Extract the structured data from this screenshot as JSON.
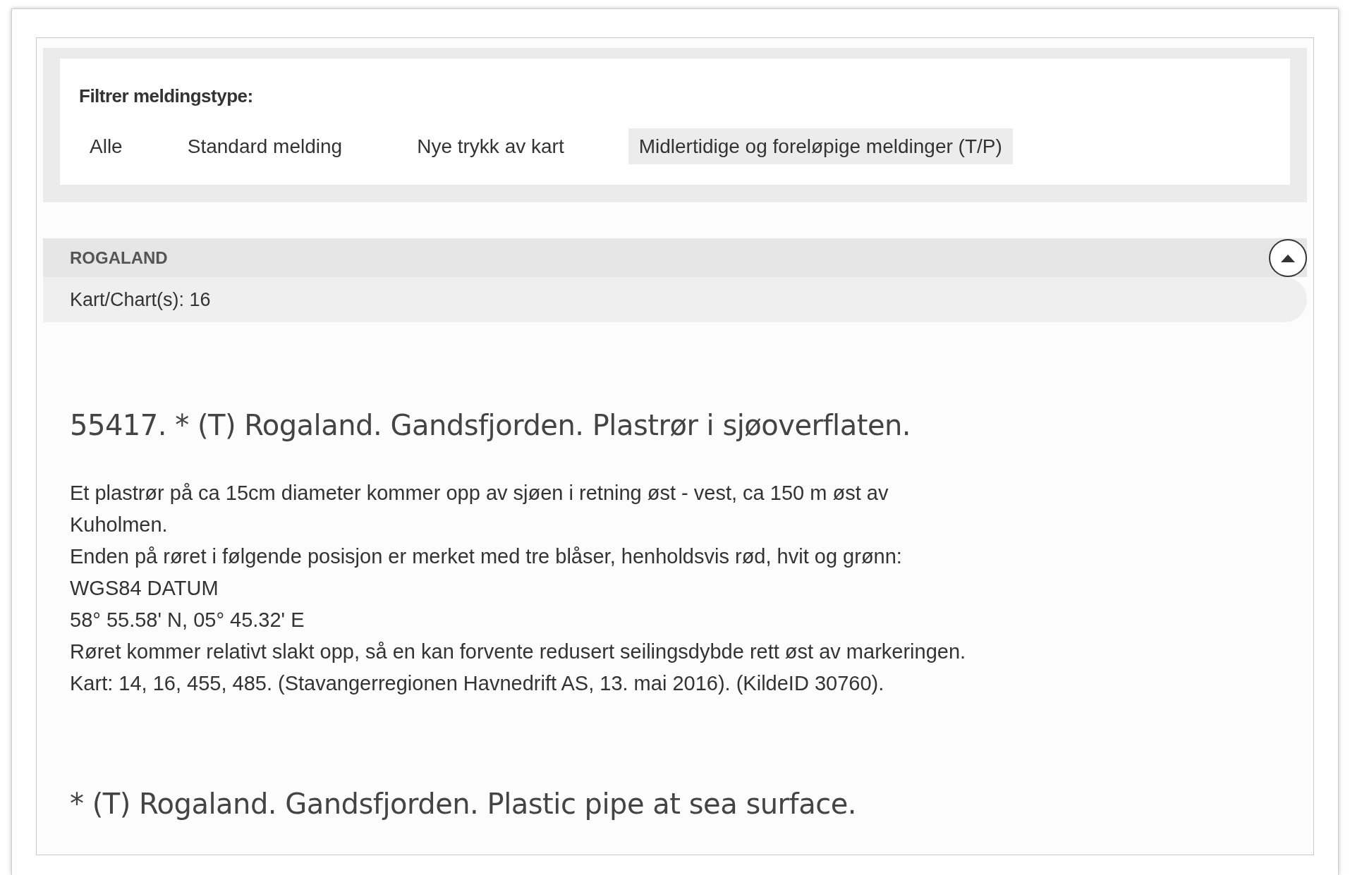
{
  "filter": {
    "heading": "Filtrer meldingstype:",
    "tabs": [
      {
        "label": "Alle",
        "selected": false
      },
      {
        "label": "Standard melding",
        "selected": false
      },
      {
        "label": "Nye trykk av kart",
        "selected": false
      },
      {
        "label": "Midlertidige og foreløpige meldinger (T/P)",
        "selected": true
      }
    ]
  },
  "region": {
    "name": "ROGALAND",
    "expanded": true,
    "charts": "Kart/Chart(s): 16"
  },
  "notices": [
    {
      "title": "55417. * (T) Rogaland. Gandsfjorden. Plastrør i sjøoverflaten.",
      "lines": [
        "Et plastrør på ca 15cm diameter kommer opp av sjøen i retning øst - vest, ca 150 m øst av",
        "Kuholmen.",
        "Enden på røret i følgende posisjon er merket med tre blåser, henholdsvis rød, hvit og grønn:",
        "WGS84 DATUM",
        "58° 55.58' N, 05° 45.32' E",
        "Røret kommer relativt slakt opp, så en kan forvente redusert seilingsdybde rett øst av markeringen.",
        "Kart: 14, 16, 455, 485. (Stavangerregionen Havnedrift AS, 13. mai 2016). (KildeID 30760)."
      ]
    },
    {
      "title": "* (T) Rogaland. Gandsfjorden. Plastic pipe at sea surface."
    }
  ]
}
